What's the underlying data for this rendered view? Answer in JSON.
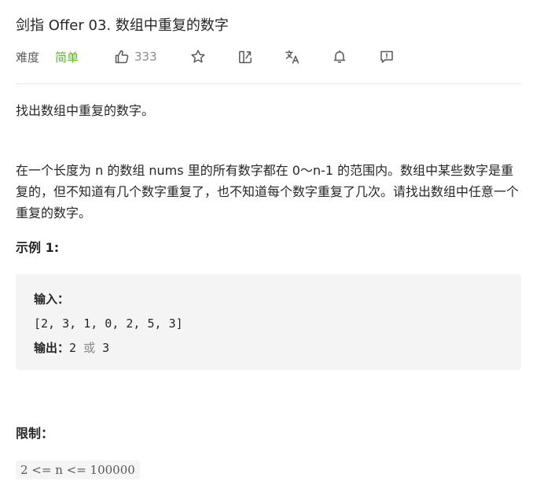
{
  "problem": {
    "title": "剑指 Offer 03. 数组中重复的数字",
    "difficulty_label": "难度",
    "difficulty_value": "简单",
    "like_count": "333"
  },
  "toolbar": {
    "icons": [
      "thumbs-up-icon",
      "star-icon",
      "share-icon",
      "translate-icon",
      "bell-icon",
      "feedback-icon"
    ]
  },
  "content": {
    "summary": "找出数组中重复的数字。",
    "description": "在一个长度为 n 的数组 nums 里的所有数字都在 0～n-1 的范围内。数组中某些数字是重复的，但不知道有几个数字重复了，也不知道每个数字重复了几次。请找出数组中任意一个重复的数字。",
    "example_heading": "示例 1:",
    "example": {
      "input_label": "输入：",
      "input_value": "[2, 3, 1, 0, 2, 5, 3]",
      "output_label": "输出：",
      "output_value_1": "2",
      "output_or": "或",
      "output_value_2": "3"
    },
    "limit_heading": "限制：",
    "constraint": "2 <= n <= 100000"
  },
  "colors": {
    "difficulty_easy": "#5ab726",
    "icon_gray": "#595959",
    "divider": "#e8e8e8",
    "code_background": "#f4f4f4"
  }
}
